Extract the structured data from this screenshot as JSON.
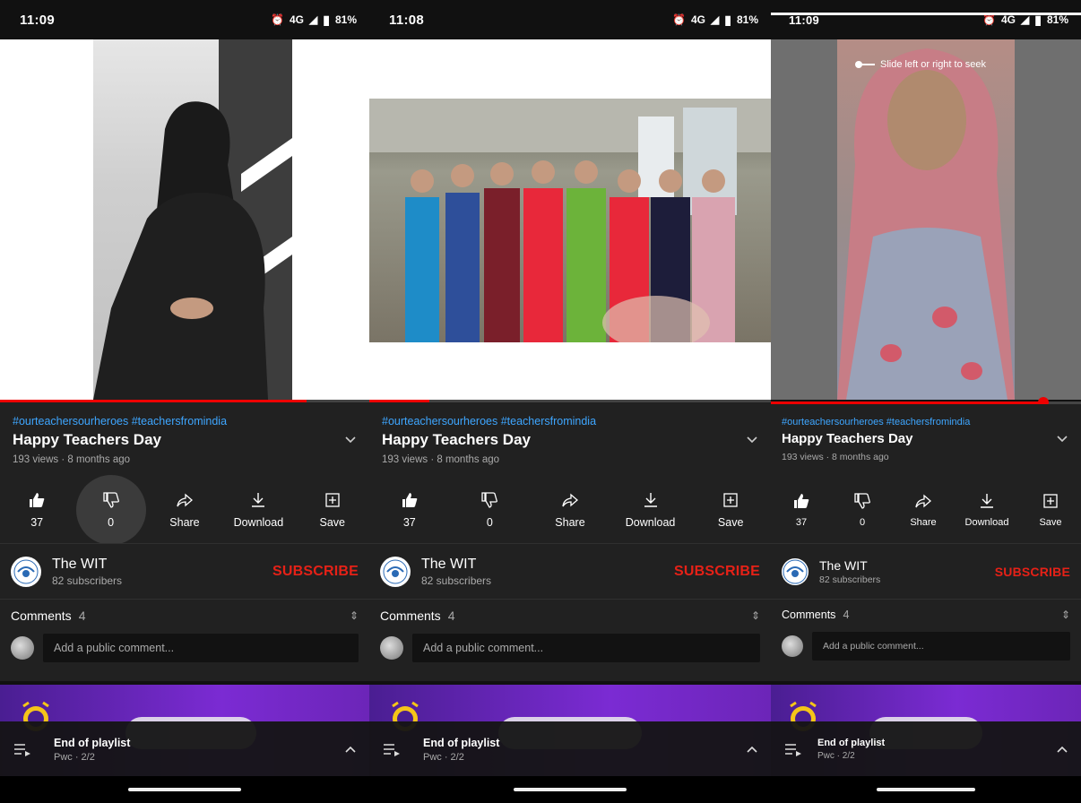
{
  "status_bar": {
    "screens": [
      {
        "time": "11:09",
        "network": "4G",
        "battery": "81%"
      },
      {
        "time": "11:08",
        "network": "4G",
        "battery": "81%"
      },
      {
        "time": "11:09",
        "network": "4G",
        "battery": "81%"
      }
    ]
  },
  "video": {
    "hashtags": "#ourteachersourheroes #teachersfromindia",
    "title": "Happy Teachers Day",
    "views_age": "193 views · 8 months ago",
    "seek_hint": "Slide left or right to seek",
    "progress": [
      0.76,
      0.15,
      0.94
    ]
  },
  "actions": {
    "like_count": "37",
    "dislike_count": "0",
    "share_label": "Share",
    "download_label": "Download",
    "save_label": "Save"
  },
  "channel": {
    "name": "The WIT",
    "subscribers": "82 subscribers",
    "subscribe_label": "SUBSCRIBE"
  },
  "comments": {
    "label": "Comments",
    "count": "4",
    "placeholder": "Add a public comment..."
  },
  "playlist": {
    "title": "End of playlist",
    "subtitle": "Pwc · 2/2"
  },
  "colors": {
    "accent_red": "#e62117",
    "link_blue": "#3ea6ff",
    "surface": "#212121"
  }
}
